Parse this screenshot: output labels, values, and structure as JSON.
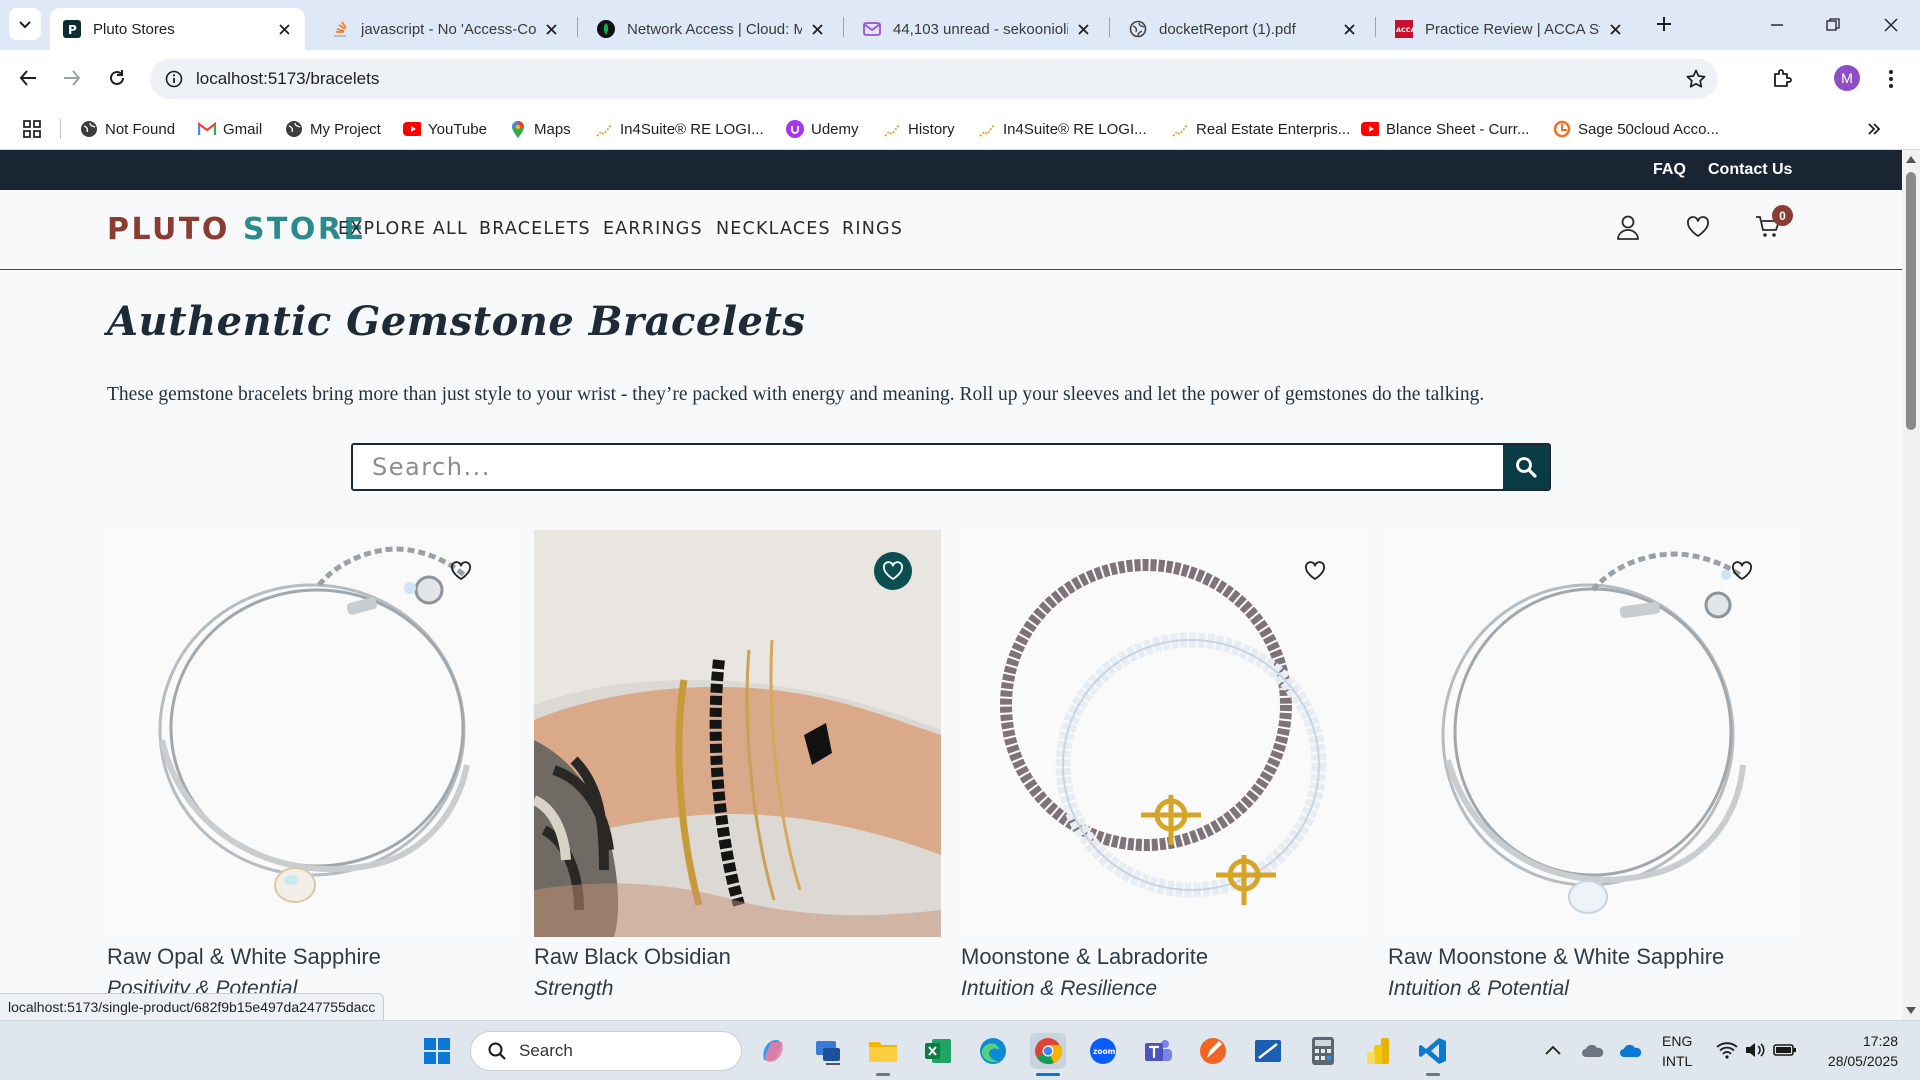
{
  "browser": {
    "tabs": [
      {
        "title": "Pluto Stores",
        "icon": "pluto-store-favicon"
      },
      {
        "title": "javascript - No 'Access-Co",
        "icon": "stackoverflow-favicon"
      },
      {
        "title": "Network Access | Cloud: M",
        "icon": "mongodb-leaf-favicon"
      },
      {
        "title": "44,103 unread - sekoonioli",
        "icon": "mail-favicon"
      },
      {
        "title": "docketReport (1).pdf",
        "icon": "globe-favicon"
      },
      {
        "title": "Practice Review | ACCA Stu",
        "icon": "acca-favicon"
      }
    ],
    "url": "localhost:5173/bracelets",
    "profile_initial": "M",
    "bookmarks": [
      {
        "label": "Not Found",
        "icon": "globe-icon"
      },
      {
        "label": "Gmail",
        "icon": "gmail-icon"
      },
      {
        "label": "My Project",
        "icon": "globe-icon"
      },
      {
        "label": "YouTube",
        "icon": "youtube-icon"
      },
      {
        "label": "Maps",
        "icon": "maps-pin-icon"
      },
      {
        "label": "In4Suite® RE LOGI...",
        "icon": "in4suite-icon"
      },
      {
        "label": "Udemy",
        "icon": "udemy-icon"
      },
      {
        "label": "History",
        "icon": "in4suite-icon"
      },
      {
        "label": "In4Suite® RE LOGI...",
        "icon": "in4suite-icon"
      },
      {
        "label": "Real Estate Enterpris...",
        "icon": "in4suite-icon"
      },
      {
        "label": "Blance Sheet - Curr...",
        "icon": "youtube-icon"
      },
      {
        "label": "Sage 50cloud Acco...",
        "icon": "sage-icon"
      }
    ],
    "status_url": "localhost:5173/single-product/682f9b15e497da247755dacc"
  },
  "store": {
    "topbar": {
      "faq": "FAQ",
      "contact": "Contact Us"
    },
    "logo": {
      "part1": "PLUTO",
      "part2": "STORE"
    },
    "nav": [
      "EXPLORE ALL",
      "BRACELETS",
      "EARRINGS",
      "NECKLACES",
      "RINGS"
    ],
    "cart_count": "0",
    "title": "Authentic Gemstone Bracelets",
    "description": "These gemstone bracelets bring more than just style to your wrist - they’re packed with energy and meaning. Roll up your sleeves and let the power of gemstones do the talking.",
    "search_placeholder": "Search...",
    "products": [
      {
        "name": "Raw Opal & White Sapphire",
        "subtitle": "Positivity & Potential",
        "favorited": false,
        "image": "silver-chain-bracelet-opal"
      },
      {
        "name": "Raw Black Obsidian",
        "subtitle": "Strength",
        "favorited": true,
        "image": "wrist-stack-black-bead-bracelet"
      },
      {
        "name": "Moonstone & Labradorite",
        "subtitle": "Intuition & Resilience",
        "favorited": false,
        "image": "beaded-bracelets-gold-clasp"
      },
      {
        "name": "Raw Moonstone & White Sapphire",
        "subtitle": "Intuition & Potential",
        "favorited": false,
        "image": "silver-chain-bracelet-moonstone"
      }
    ],
    "colors": {
      "dark": "#1a2533",
      "accent_red": "#8a3b32",
      "accent_teal": "#2a8a8c",
      "button": "#0b3c45"
    }
  },
  "taskbar": {
    "search_label": "Search",
    "language": "ENG",
    "layout": "INTL",
    "time": "17:28",
    "date": "28/05/2025"
  }
}
